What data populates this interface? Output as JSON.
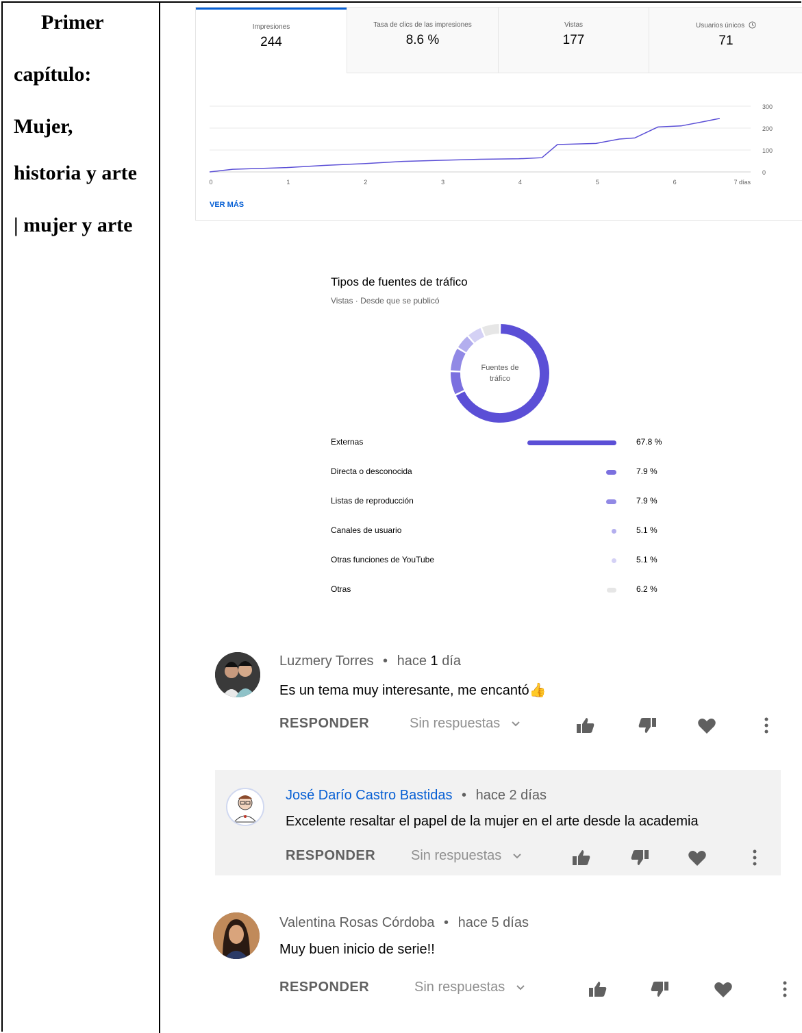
{
  "left_cell": {
    "lines": [
      "Primer",
      "capítulo:",
      "Mujer,",
      "historia y arte",
      "| mujer y arte"
    ]
  },
  "metrics": [
    {
      "label": "Impresiones",
      "value": "244"
    },
    {
      "label": "Tasa de clics de las impresiones",
      "value": "8.6 %"
    },
    {
      "label": "Vistas",
      "value": "177"
    },
    {
      "label": "Usuarios únicos",
      "value": "71"
    }
  ],
  "chart_data": {
    "type": "line",
    "x": [
      0,
      0.3,
      1,
      1.5,
      2,
      2.5,
      3,
      3.5,
      4,
      4.3,
      4.5,
      5,
      5.3,
      5.5,
      5.8,
      6.1,
      6.4,
      6.6
    ],
    "y": [
      0,
      12,
      20,
      30,
      38,
      48,
      53,
      58,
      60,
      65,
      125,
      130,
      150,
      155,
      205,
      210,
      230,
      244
    ],
    "xlim": [
      0,
      7
    ],
    "ylim": [
      0,
      300
    ],
    "xticks": [
      "0",
      "1",
      "2",
      "3",
      "4",
      "5",
      "6",
      "7 días"
    ],
    "yticks": [
      "0",
      "100",
      "200",
      "300"
    ],
    "color": "#5b4fd6"
  },
  "ver_mas": "VER MÁS",
  "traffic": {
    "title": "Tipos de fuentes de tráfico",
    "subtitle": "Vistas · Desde que se publicó",
    "donut_label_1": "Fuentes de",
    "donut_label_2": "tráfico",
    "sources": [
      {
        "name": "Externas",
        "value": 67.8,
        "label": "67.8 %",
        "color": "#5b4fd6"
      },
      {
        "name": "Directa o desconocida",
        "value": 7.9,
        "label": "7.9 %",
        "color": "#7b70df"
      },
      {
        "name": "Listas de reproducción",
        "value": 7.9,
        "label": "7.9 %",
        "color": "#9189e5"
      },
      {
        "name": "Canales de usuario",
        "value": 5.1,
        "label": "5.1 %",
        "color": "#b3aeee"
      },
      {
        "name": "Otras funciones de YouTube",
        "value": 5.1,
        "label": "5.1 %",
        "color": "#d4d1f5"
      },
      {
        "name": "Otras",
        "value": 6.2,
        "label": "6.2 %",
        "color": "#e6e6e6"
      }
    ]
  },
  "comments": [
    {
      "author": "Luzmery Torres",
      "sep": "•",
      "when_pre": "hace ",
      "when_num": "1",
      "when_post": " día",
      "text": "Es un tema muy interesante, me encantó👍",
      "reply": "RESPONDER",
      "replies": "Sin respuestas"
    },
    {
      "author": "José Darío Castro Bastidas",
      "sep": "•",
      "when_pre": "hace 2 días",
      "when_num": "",
      "when_post": "",
      "text": "Excelente resaltar el papel de la mujer en el arte desde la academia",
      "reply": "RESPONDER",
      "replies": "Sin respuestas"
    },
    {
      "author": "Valentina Rosas Córdoba",
      "sep": "•",
      "when_pre": "hace 5 días",
      "when_num": "",
      "when_post": "",
      "text": "Muy buen inicio de serie!!",
      "reply": "RESPONDER",
      "replies": "Sin respuestas"
    }
  ]
}
